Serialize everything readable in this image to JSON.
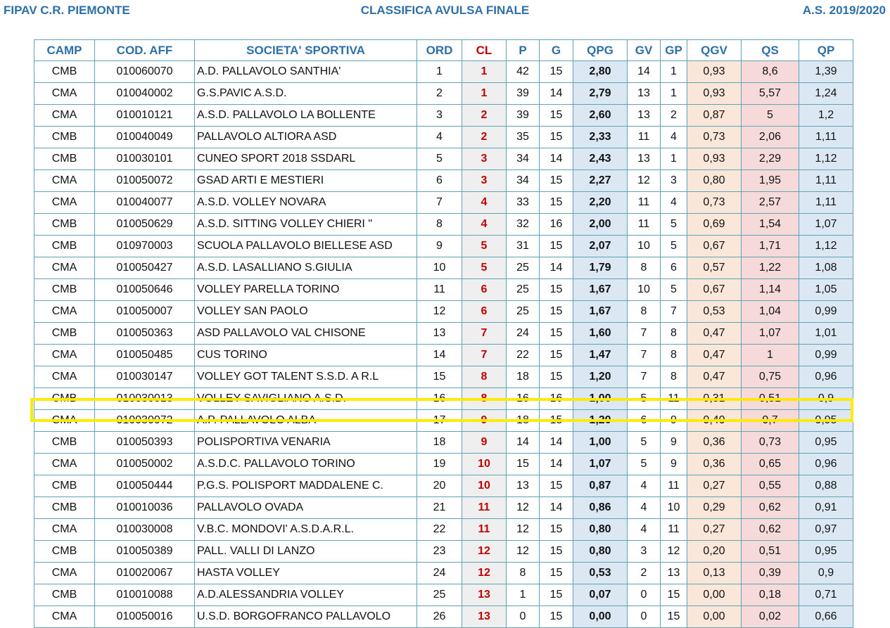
{
  "header": {
    "left": "FIPAV C.R. PIEMONTE",
    "center": "CLASSIFICA AVULSA FINALE",
    "right": "A.S. 2019/2020"
  },
  "columns": [
    "CAMP",
    "COD. AFF",
    "SOCIETA' SPORTIVA",
    "ORD",
    "CL",
    "P",
    "G",
    "QPG",
    "GV",
    "GP",
    "QGV",
    "QS",
    "QP"
  ],
  "highlighted_row": 16,
  "colors": {
    "header_text": "#2e6fa8",
    "cl_text": "#c00000",
    "border": "#5fa4b4",
    "highlight": "#ffea00"
  },
  "rows": [
    [
      "CMB",
      "010060070",
      "A.D. PALLAVOLO SANTHIA'",
      "1",
      "1",
      "42",
      "15",
      "2,80",
      "14",
      "1",
      "0,93",
      "8,6",
      "1,39"
    ],
    [
      "CMA",
      "010040002",
      "G.S.PAVIC A.S.D.",
      "2",
      "1",
      "39",
      "14",
      "2,79",
      "13",
      "1",
      "0,93",
      "5,57",
      "1,24"
    ],
    [
      "CMA",
      "010010121",
      "A.S.D. PALLAVOLO LA BOLLENTE",
      "3",
      "2",
      "39",
      "15",
      "2,60",
      "13",
      "2",
      "0,87",
      "5",
      "1,2"
    ],
    [
      "CMB",
      "010040049",
      "PALLAVOLO ALTIORA ASD",
      "4",
      "2",
      "35",
      "15",
      "2,33",
      "11",
      "4",
      "0,73",
      "2,06",
      "1,11"
    ],
    [
      "CMB",
      "010030101",
      "CUNEO SPORT 2018 SSDARL",
      "5",
      "3",
      "34",
      "14",
      "2,43",
      "13",
      "1",
      "0,93",
      "2,29",
      "1,12"
    ],
    [
      "CMA",
      "010050072",
      "GSAD ARTI E MESTIERI",
      "6",
      "3",
      "34",
      "15",
      "2,27",
      "12",
      "3",
      "0,80",
      "1,95",
      "1,11"
    ],
    [
      "CMA",
      "010040077",
      "A.S.D. VOLLEY NOVARA",
      "7",
      "4",
      "33",
      "15",
      "2,20",
      "11",
      "4",
      "0,73",
      "2,57",
      "1,11"
    ],
    [
      "CMB",
      "010050629",
      "A.S.D. SITTING VOLLEY CHIERI \"",
      "8",
      "4",
      "32",
      "16",
      "2,00",
      "11",
      "5",
      "0,69",
      "1,54",
      "1,07"
    ],
    [
      "CMB",
      "010970003",
      "SCUOLA PALLAVOLO BIELLESE ASD",
      "9",
      "5",
      "31",
      "15",
      "2,07",
      "10",
      "5",
      "0,67",
      "1,71",
      "1,12"
    ],
    [
      "CMA",
      "010050427",
      "A.S.D. LASALLIANO S.GIULIA",
      "10",
      "5",
      "25",
      "14",
      "1,79",
      "8",
      "6",
      "0,57",
      "1,22",
      "1,08"
    ],
    [
      "CMB",
      "010050646",
      "VOLLEY PARELLA TORINO",
      "11",
      "6",
      "25",
      "15",
      "1,67",
      "10",
      "5",
      "0,67",
      "1,14",
      "1,05"
    ],
    [
      "CMA",
      "010050007",
      "VOLLEY SAN PAOLO",
      "12",
      "6",
      "25",
      "15",
      "1,67",
      "8",
      "7",
      "0,53",
      "1,04",
      "0,99"
    ],
    [
      "CMB",
      "010050363",
      "ASD PALLAVOLO VAL CHISONE",
      "13",
      "7",
      "24",
      "15",
      "1,60",
      "7",
      "8",
      "0,47",
      "1,07",
      "1,01"
    ],
    [
      "CMA",
      "010050485",
      "CUS TORINO",
      "14",
      "7",
      "22",
      "15",
      "1,47",
      "7",
      "8",
      "0,47",
      "1",
      "0,99"
    ],
    [
      "CMA",
      "010030147",
      "VOLLEY GOT TALENT S.S.D. A R.L",
      "15",
      "8",
      "18",
      "15",
      "1,20",
      "7",
      "8",
      "0,47",
      "0,75",
      "0,96"
    ],
    [
      "CMB",
      "010030013",
      "VOLLEY SAVIGLIANO A.S.D.",
      "16",
      "8",
      "16",
      "16",
      "1,00",
      "5",
      "11",
      "0,31",
      "0,51",
      "0,9"
    ],
    [
      "CMA",
      "010030072",
      "A.P. PALLAVOLO ALBA",
      "17",
      "9",
      "18",
      "15",
      "1,20",
      "6",
      "9",
      "0,40",
      "0,7",
      "0,95"
    ],
    [
      "CMB",
      "010050393",
      "POLISPORTIVA VENARIA",
      "18",
      "9",
      "14",
      "14",
      "1,00",
      "5",
      "9",
      "0,36",
      "0,73",
      "0,95"
    ],
    [
      "CMA",
      "010050002",
      "A.S.D.C. PALLAVOLO TORINO",
      "19",
      "10",
      "15",
      "14",
      "1,07",
      "5",
      "9",
      "0,36",
      "0,65",
      "0,96"
    ],
    [
      "CMB",
      "010050444",
      "P.G.S. POLISPORT MADDALENE C.",
      "20",
      "10",
      "13",
      "15",
      "0,87",
      "4",
      "11",
      "0,27",
      "0,55",
      "0,88"
    ],
    [
      "CMB",
      "010010036",
      "PALLAVOLO OVADA",
      "21",
      "11",
      "12",
      "14",
      "0,86",
      "4",
      "10",
      "0,29",
      "0,62",
      "0,91"
    ],
    [
      "CMA",
      "010030008",
      "V.B.C. MONDOVI' A.S.D.A.R.L.",
      "22",
      "11",
      "12",
      "15",
      "0,80",
      "4",
      "11",
      "0,27",
      "0,62",
      "0,97"
    ],
    [
      "CMB",
      "010050389",
      "PALL. VALLI DI LANZO",
      "23",
      "12",
      "12",
      "15",
      "0,80",
      "3",
      "12",
      "0,20",
      "0,51",
      "0,95"
    ],
    [
      "CMA",
      "010020067",
      "HASTA VOLLEY",
      "24",
      "12",
      "8",
      "15",
      "0,53",
      "2",
      "13",
      "0,13",
      "0,39",
      "0,9"
    ],
    [
      "CMB",
      "010010088",
      "A.D.ALESSANDRIA VOLLEY",
      "25",
      "13",
      "1",
      "15",
      "0,07",
      "0",
      "15",
      "0,00",
      "0,18",
      "0,71"
    ],
    [
      "CMA",
      "010050016",
      "U.S.D. BORGOFRANCO PALLAVOLO",
      "26",
      "13",
      "0",
      "15",
      "0,00",
      "0",
      "15",
      "0,00",
      "0,02",
      "0,66"
    ]
  ]
}
